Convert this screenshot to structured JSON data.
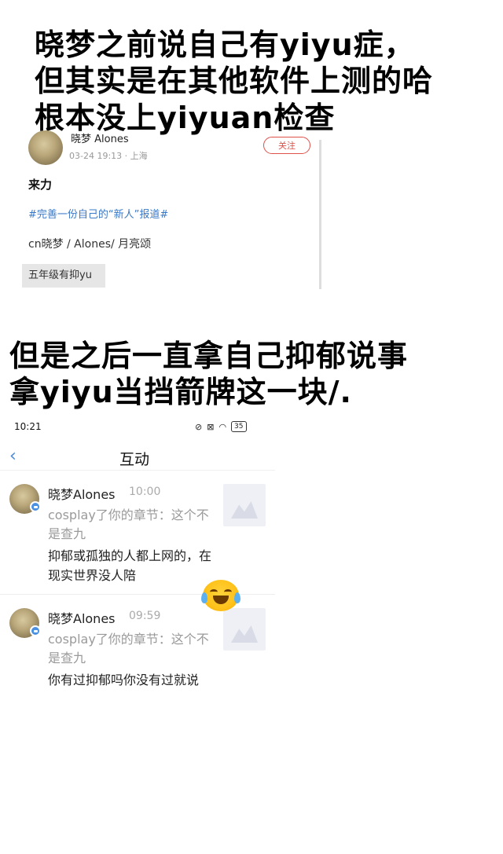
{
  "caption_top": {
    "lines": [
      "晓梦之前说自己有yiyu症，",
      "但其实是在其他软件上测的哈",
      "根本没上yiyuan检查"
    ]
  },
  "post": {
    "username": "晓梦 Alones",
    "meta": "03-24 19:13 · 上海",
    "follow_label": "关注",
    "title": "来力",
    "tag": "#完善一份自己的“新人”报道#",
    "cn_line": "cn晓梦 / Alones/ 月亮颂",
    "highlight_text": "五年级有抑yu"
  },
  "caption_middle": {
    "lines": [
      "但是之后一直拿自己抑郁说事",
      "拿yiyu当挡箭牌这一块/."
    ]
  },
  "phone": {
    "time": "10:21",
    "battery": "35",
    "nav_title": "互动",
    "back_icon": "chevron-left-icon",
    "items": [
      {
        "username": "晓梦Alones",
        "time": "10:00",
        "quote": "cosplay了你的章节：这个不是查九",
        "reply": "抑郁或孤独的人都上网的，在现实世界没人陪"
      },
      {
        "username": "晓梦Alones",
        "time": "09:59",
        "quote": "cosplay了你的章节：这个不是查九",
        "reply": "你有过抑郁吗你没有过就说"
      }
    ]
  },
  "emoji": "laughing-tears-emoji",
  "colors": {
    "accent_red": "#e0504a",
    "link_blue": "#3a78c8",
    "nav_blue": "#4a8ad8"
  }
}
